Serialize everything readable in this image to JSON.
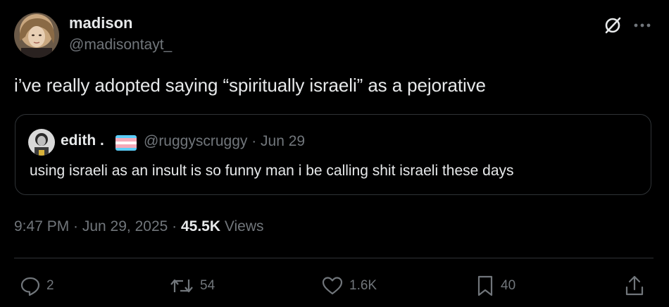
{
  "tweet": {
    "display_name": "madison",
    "handle": "@madisontayt_",
    "text": "i’ve really adopted saying “spiritually israeli” as a pejorative"
  },
  "quote": {
    "display_name": "edith .",
    "handle_date": "@ruggyscruggy · Jun 29",
    "text": "using israeli as an insult is so funny man i be calling shit israeli these days"
  },
  "meta": {
    "timestamp": "9:47 PM · Jun 29, 2025 · ",
    "views_count": "45.5K",
    "views_label": " Views"
  },
  "actions": {
    "replies": "2",
    "reposts": "54",
    "likes": "1.6K",
    "bookmarks": "40"
  },
  "icons": {
    "header": [
      "grok-icon",
      "more-icon"
    ],
    "actions": [
      "reply-icon",
      "repost-icon",
      "like-icon",
      "bookmark-icon",
      "share-icon"
    ]
  },
  "colors": {
    "background": "#000000",
    "text_primary": "#e7e9ea",
    "text_secondary": "#71767b",
    "border": "#2f3336",
    "trans_flag": [
      "#5bcefa",
      "#f5a9b8",
      "#ffffff",
      "#f5a9b8",
      "#5bcefa"
    ]
  }
}
